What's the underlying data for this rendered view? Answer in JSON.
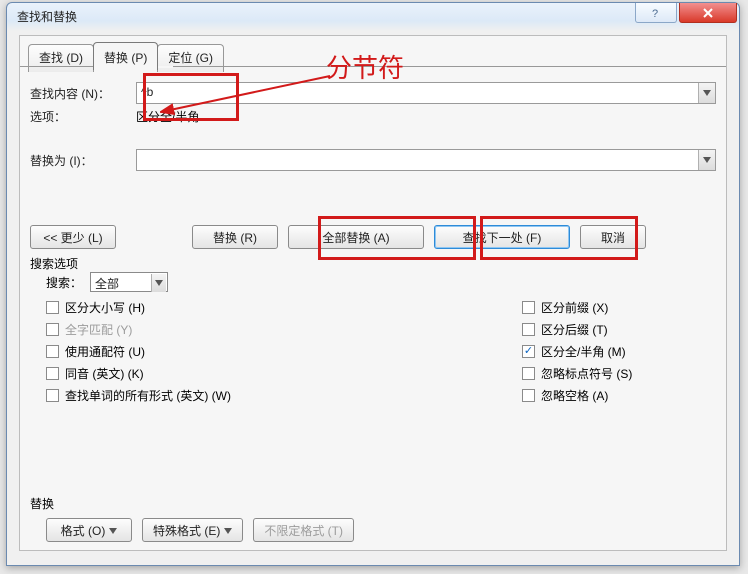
{
  "window": {
    "title": "查找和替换"
  },
  "tabs": {
    "find": "查找 (D)",
    "replace": "替换 (P)",
    "goto": "定位 (G)"
  },
  "labels": {
    "find_what": "查找内容 (N)：",
    "options_line": "选项：",
    "options_value": "区分全/半角",
    "replace_with": "替换为 (I)：",
    "search_options": "搜索选项",
    "search": "搜索：",
    "replace_section": "替换"
  },
  "inputs": {
    "find_value": "^b",
    "replace_value": "",
    "search_scope": "全部"
  },
  "buttons": {
    "less": "<<  更少 (L)",
    "replace": "替换 (R)",
    "replace_all": "全部替换 (A)",
    "find_next": "查找下一处 (F)",
    "cancel": "取消",
    "format": "格式 (O)",
    "special": "特殊格式 (E)",
    "noformat": "不限定格式 (T)"
  },
  "checks_left": [
    {
      "label": "区分大小写 (H)",
      "checked": false,
      "disabled": false
    },
    {
      "label": "全字匹配 (Y)",
      "checked": false,
      "disabled": true
    },
    {
      "label": "使用通配符 (U)",
      "checked": false,
      "disabled": false
    },
    {
      "label": "同音 (英文) (K)",
      "checked": false,
      "disabled": false
    },
    {
      "label": "查找单词的所有形式 (英文) (W)",
      "checked": false,
      "disabled": false
    }
  ],
  "checks_right": [
    {
      "label": "区分前缀 (X)",
      "checked": false
    },
    {
      "label": "区分后缀 (T)",
      "checked": false
    },
    {
      "label": "区分全/半角 (M)",
      "checked": true
    },
    {
      "label": "忽略标点符号 (S)",
      "checked": false
    },
    {
      "label": "忽略空格 (A)",
      "checked": false
    }
  ],
  "annotation": {
    "text": "分节符"
  }
}
